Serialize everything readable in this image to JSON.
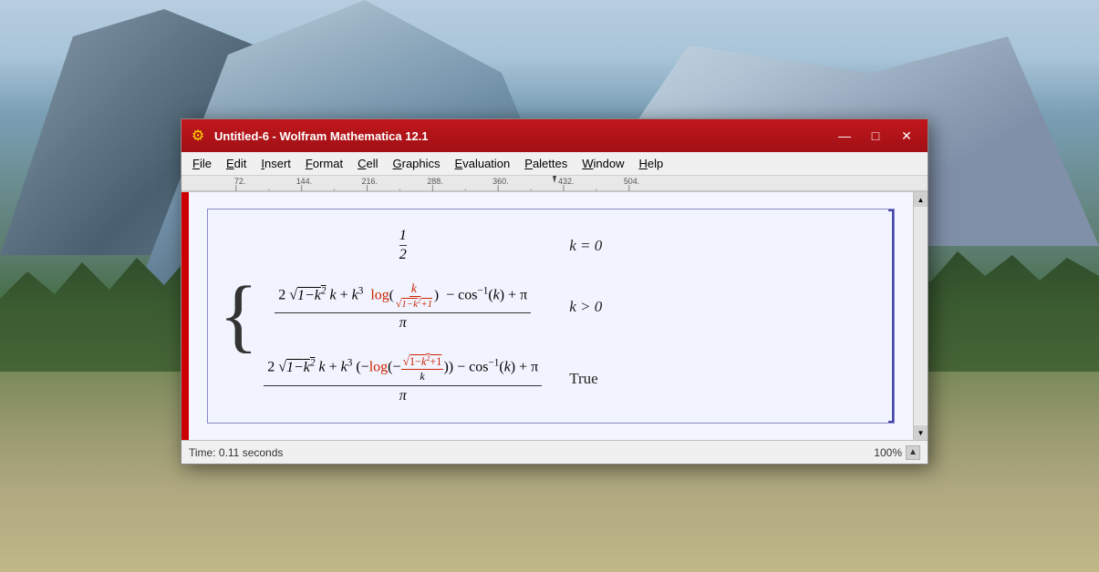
{
  "window": {
    "title": "Untitled-6 - Wolfram Mathematica 12.1",
    "icon": "⚙",
    "minimize_label": "—",
    "maximize_label": "□",
    "close_label": "✕"
  },
  "menu": {
    "items": [
      {
        "label": "File",
        "underline": true
      },
      {
        "label": "Edit",
        "underline": true
      },
      {
        "label": "Insert",
        "underline": true
      },
      {
        "label": "Format",
        "underline": true
      },
      {
        "label": "Cell",
        "underline": true
      },
      {
        "label": "Graphics",
        "underline": true
      },
      {
        "label": "Evaluation",
        "underline": true
      },
      {
        "label": "Palettes",
        "underline": true
      },
      {
        "label": "Window",
        "underline": true
      },
      {
        "label": "Help",
        "underline": true
      }
    ]
  },
  "status": {
    "time_text": "Time: 0.11 seconds",
    "zoom_value": "100%"
  },
  "math": {
    "case1_simple": "1/2",
    "case1_cond": "k = 0",
    "case2_cond": "k > 0",
    "case3_cond": "True"
  }
}
